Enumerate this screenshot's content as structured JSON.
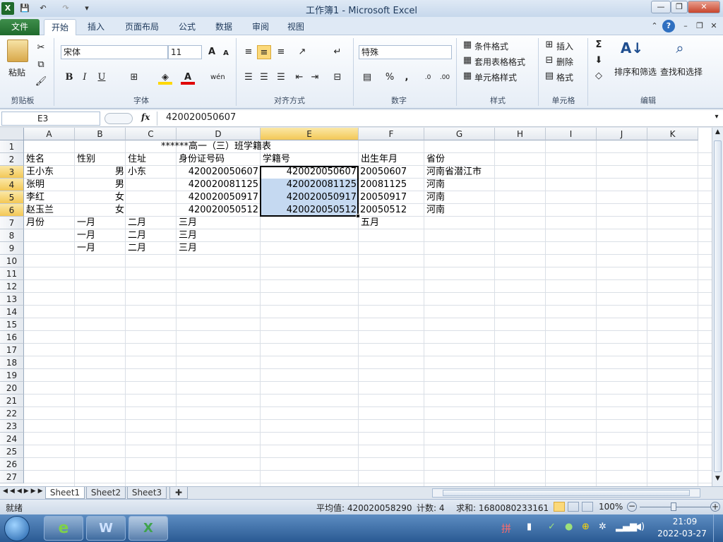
{
  "window": {
    "title": "工作簿1 - Microsoft Excel"
  },
  "quick_access": {
    "save": "💾",
    "undo": "↶",
    "redo": "↷"
  },
  "tabs": [
    {
      "label": "文件"
    },
    {
      "label": "开始"
    },
    {
      "label": "插入"
    },
    {
      "label": "页面布局"
    },
    {
      "label": "公式"
    },
    {
      "label": "数据"
    },
    {
      "label": "审阅"
    },
    {
      "label": "视图"
    }
  ],
  "ribbon": {
    "clipboard": {
      "paste": "粘贴",
      "group": "剪贴板"
    },
    "font": {
      "name": "宋体",
      "size": "11",
      "bold": "B",
      "italic": "I",
      "underline": "U",
      "grow": "A",
      "shrink": "A",
      "group": "字体",
      "wen": "wén"
    },
    "alignment": {
      "group": "对齐方式"
    },
    "number": {
      "format": "特殊",
      "percent": "%",
      "comma": ",",
      "group": "数字"
    },
    "styles": {
      "cond": "条件格式",
      "table": "套用表格格式",
      "cell": "单元格样式",
      "group": "样式"
    },
    "cells": {
      "insert": "插入",
      "delete": "删除",
      "format": "格式",
      "group": "单元格"
    },
    "editing": {
      "sigma": "Σ",
      "sort": "排序和筛选",
      "find": "查找和选择",
      "group": "编辑"
    }
  },
  "formula_bar": {
    "name_box": "E3",
    "fx": "fx",
    "value": "420020050607"
  },
  "columns": [
    "A",
    "B",
    "C",
    "D",
    "E",
    "F",
    "G",
    "H",
    "I",
    "J",
    "K"
  ],
  "rows": [
    "1",
    "2",
    "3",
    "4",
    "5",
    "6",
    "7",
    "8",
    "9",
    "10",
    "11",
    "12",
    "13",
    "14",
    "15",
    "16",
    "17",
    "18",
    "19",
    "20",
    "21",
    "22",
    "23",
    "24",
    "25",
    "26",
    "27"
  ],
  "cells": {
    "r1": {
      "title": "******高一（三）班学籍表"
    },
    "r2": {
      "a": "姓名",
      "b": "性别",
      "c": "住址",
      "d": "身份证号码",
      "e": "学籍号",
      "f": "出生年月",
      "g": "省份"
    },
    "r3": {
      "a": "王小东",
      "b": "男",
      "c": "小东",
      "d": "420020050607",
      "e": "420020050607",
      "f": "20050607",
      "g": "河南省潜江市"
    },
    "r4": {
      "a": "张明",
      "b": "男",
      "c": "",
      "d": "420020081125",
      "e": "420020081125",
      "f": "20081125",
      "g": "河南"
    },
    "r5": {
      "a": "李红",
      "b": "女",
      "c": "",
      "d": "420020050917",
      "e": "420020050917",
      "f": "20050917",
      "g": "河南"
    },
    "r6": {
      "a": "赵玉兰",
      "b": "女",
      "c": "",
      "d": "420020050512",
      "e": "420020050512",
      "f": "20050512",
      "g": "河南"
    },
    "r7": {
      "a": "月份",
      "b": "一月",
      "c": "二月",
      "d": "三月",
      "f": "五月"
    },
    "r8": {
      "b": "一月",
      "c": "二月",
      "d": "三月"
    },
    "r9": {
      "b": "一月",
      "c": "二月",
      "d": "三月"
    }
  },
  "sheets": [
    "Sheet1",
    "Sheet2",
    "Sheet3"
  ],
  "status": {
    "ready": "就绪",
    "avg": "平均值: 420020058290",
    "count": "计数: 4",
    "sum": "求和: 1680080233161",
    "zoom": "100%"
  },
  "clock": {
    "time": "21:09",
    "date": "2022-03-27"
  },
  "taskbar": {
    "ie": "e",
    "word": "W",
    "excel": "X"
  },
  "colors": {
    "accent": "#2a6f35",
    "selection": "#c5d9f1",
    "header_sel": "#f3c756"
  }
}
